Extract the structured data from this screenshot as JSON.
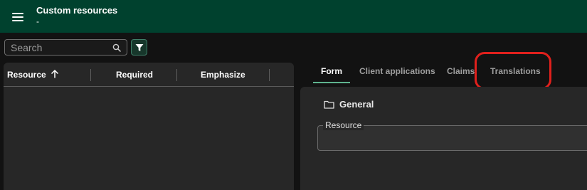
{
  "appbar": {
    "title": "Custom resources",
    "subtitle": "-",
    "menu_icon": "hamburger-menu-icon",
    "background": "#00412e"
  },
  "search": {
    "placeholder": "Search",
    "value": "",
    "icon": "search-icon"
  },
  "filter": {
    "icon": "filter-icon",
    "accent": "#3f7f68"
  },
  "table": {
    "columns": [
      {
        "label": "Resource",
        "sort": "ascending"
      },
      {
        "label": "Required"
      },
      {
        "label": "Emphasize"
      }
    ],
    "rows": []
  },
  "tabs": [
    {
      "label": "Form",
      "active": true
    },
    {
      "label": "Client applications",
      "active": false
    },
    {
      "label": "Claims",
      "active": false
    },
    {
      "label": "Translations",
      "active": false,
      "highlighted": true
    }
  ],
  "form": {
    "group_label": "General",
    "group_icon": "folder-icon",
    "fields": [
      {
        "label": "Resource",
        "value": ""
      }
    ]
  },
  "colors": {
    "tab_underline": "#5fb38f",
    "highlight_ring": "#e0201c"
  }
}
